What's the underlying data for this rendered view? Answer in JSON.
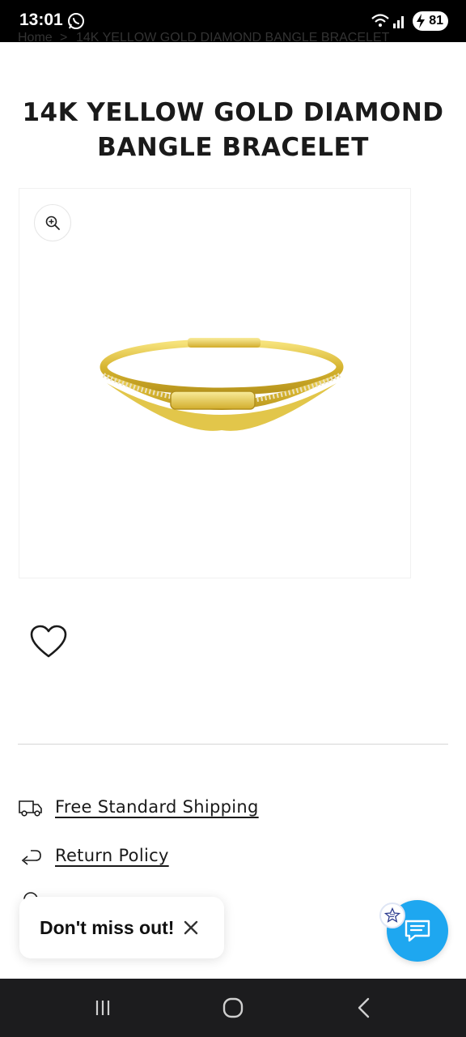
{
  "status_bar": {
    "time": "13:01",
    "battery": "81",
    "icons": [
      "whatsapp-icon",
      "wifi-icon",
      "signal-icon",
      "battery-icon"
    ]
  },
  "breadcrumb": {
    "home": "Home",
    "separator": ">",
    "current": "14K YELLOW GOLD DIAMOND BANGLE BRACELET"
  },
  "product": {
    "title": "14K YELLOW GOLD DIAMOND BANGLE BRACELET"
  },
  "info": {
    "shipping_label": "Free Standard Shipping",
    "return_label": "Return Policy"
  },
  "toast": {
    "text": "Don't miss out!"
  },
  "colors": {
    "chat_accent": "#1ea7f0",
    "gold": "#d8b83a"
  }
}
